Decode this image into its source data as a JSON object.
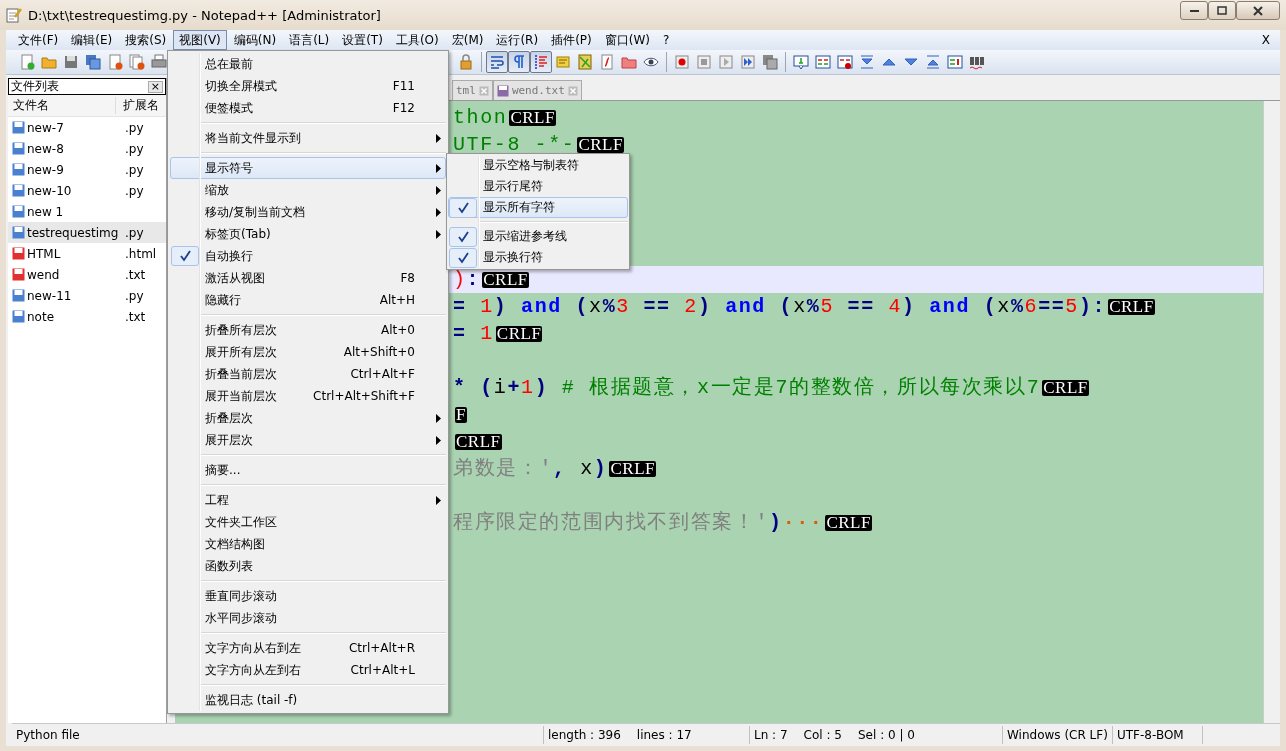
{
  "window": {
    "title": "D:\\txt\\testrequestimg.py - Notepad++ [Administrator]"
  },
  "menubar": {
    "items": [
      {
        "label": "文件(F)",
        "selected": false
      },
      {
        "label": "编辑(E)",
        "selected": false
      },
      {
        "label": "搜索(S)",
        "selected": false
      },
      {
        "label": "视图(V)",
        "selected": true
      },
      {
        "label": "编码(N)",
        "selected": false
      },
      {
        "label": "语言(L)",
        "selected": false
      },
      {
        "label": "设置(T)",
        "selected": false
      },
      {
        "label": "工具(O)",
        "selected": false
      },
      {
        "label": "宏(M)",
        "selected": false
      },
      {
        "label": "运行(R)",
        "selected": false
      },
      {
        "label": "插件(P)",
        "selected": false
      },
      {
        "label": "窗口(W)",
        "selected": false
      },
      {
        "label": "?",
        "selected": false
      }
    ],
    "close_label": "X"
  },
  "toolbar": {
    "left": [
      {
        "kind": "new",
        "pressed": false
      },
      {
        "kind": "open",
        "pressed": false
      },
      {
        "kind": "save",
        "pressed": false
      },
      {
        "kind": "saveall",
        "pressed": false
      },
      {
        "kind": "close",
        "pressed": false
      },
      {
        "kind": "closeall",
        "pressed": false
      },
      {
        "kind": "print",
        "pressed": false
      }
    ],
    "right": [
      {
        "kind": "lock",
        "pressed": false
      },
      {
        "kind": "sep"
      },
      {
        "kind": "wrap",
        "pressed": true
      },
      {
        "kind": "pilcrow",
        "pressed": true
      },
      {
        "kind": "indent",
        "pressed": true
      },
      {
        "kind": "note",
        "pressed": false
      },
      {
        "kind": "map",
        "pressed": false
      },
      {
        "kind": "func",
        "pressed": false
      },
      {
        "kind": "folder",
        "pressed": false
      },
      {
        "kind": "eye",
        "pressed": false
      },
      {
        "kind": "sep"
      },
      {
        "kind": "record",
        "pressed": false
      },
      {
        "kind": "stop",
        "pressed": false
      },
      {
        "kind": "play",
        "pressed": false
      },
      {
        "kind": "playmulti",
        "pressed": false
      },
      {
        "kind": "savemacro",
        "pressed": false
      },
      {
        "kind": "sep"
      },
      {
        "kind": "bookmark",
        "pressed": false
      },
      {
        "kind": "compare",
        "pressed": false
      },
      {
        "kind": "clearcompare",
        "pressed": false
      },
      {
        "kind": "first",
        "pressed": false
      },
      {
        "kind": "prev",
        "pressed": false
      },
      {
        "kind": "next",
        "pressed": false
      },
      {
        "kind": "last",
        "pressed": false
      },
      {
        "kind": "panel",
        "pressed": false
      },
      {
        "kind": "spell",
        "pressed": false
      }
    ]
  },
  "file_list": {
    "title": "文件列表",
    "close_label": "×",
    "columns": [
      "文件名",
      "扩展名"
    ],
    "rows": [
      {
        "name": "new-7",
        "ext": ".py",
        "modified": false,
        "selected": false
      },
      {
        "name": "new-8",
        "ext": ".py",
        "modified": false,
        "selected": false
      },
      {
        "name": "new-9",
        "ext": ".py",
        "modified": false,
        "selected": false
      },
      {
        "name": "new-10",
        "ext": ".py",
        "modified": false,
        "selected": false
      },
      {
        "name": "new 1",
        "modified": false,
        "selected": false
      },
      {
        "name": "testrequestimg",
        "ext": ".py",
        "modified": false,
        "selected": true
      },
      {
        "name": "HTML",
        "ext": ".html",
        "modified": true,
        "selected": false
      },
      {
        "name": "wend",
        "ext": ".txt",
        "modified": true,
        "selected": false
      },
      {
        "name": "new-11",
        "ext": ".py",
        "modified": false,
        "selected": false
      },
      {
        "name": "note",
        "ext": ".txt",
        "modified": false,
        "selected": false
      }
    ]
  },
  "tabs": [
    {
      "label": "tml",
      "selected": false
    },
    {
      "label": "wend.txt",
      "selected": false
    }
  ],
  "editor": {
    "lines": [
      {
        "current": false,
        "tokens": [
          {
            "text": "thon",
            "kind": "comment"
          },
          {
            "text": "CRLF",
            "kind": "eol"
          }
        ]
      },
      {
        "current": false,
        "tokens": [
          {
            "text": "UTF-8 -*-",
            "kind": "comment"
          },
          {
            "text": "CRLF",
            "kind": "eol"
          }
        ]
      },
      {
        "current": false
      },
      {
        "current": false
      },
      {
        "current": false
      },
      {
        "current": false
      },
      {
        "current": true,
        "tokens": [
          {
            "text": ")",
            "kind": "number"
          },
          {
            "text": ":",
            "kind": "operator"
          },
          {
            "text": "CRLF",
            "kind": "eol"
          }
        ]
      },
      {
        "current": false,
        "tokens": [
          {
            "text": "=",
            "kind": "operator"
          },
          {
            "text": " 1",
            "kind": "number"
          },
          {
            "text": ")",
            "kind": "operator"
          },
          {
            "text": " and",
            "kind": "keyword"
          },
          {
            "text": " (",
            "kind": "operator"
          },
          {
            "text": "x",
            "kind": "identifier"
          },
          {
            "text": "%",
            "kind": "operator"
          },
          {
            "text": "3",
            "kind": "number"
          },
          {
            "text": " ==",
            "kind": "operator"
          },
          {
            "text": " 2",
            "kind": "number"
          },
          {
            "text": ")",
            "kind": "operator"
          },
          {
            "text": " and",
            "kind": "keyword"
          },
          {
            "text": " (",
            "kind": "operator"
          },
          {
            "text": "x",
            "kind": "identifier"
          },
          {
            "text": "%",
            "kind": "operator"
          },
          {
            "text": "5",
            "kind": "number"
          },
          {
            "text": " ==",
            "kind": "operator"
          },
          {
            "text": " 4",
            "kind": "number"
          },
          {
            "text": ")",
            "kind": "operator"
          },
          {
            "text": " and",
            "kind": "keyword"
          },
          {
            "text": " (",
            "kind": "operator"
          },
          {
            "text": "x",
            "kind": "identifier"
          },
          {
            "text": "%",
            "kind": "operator"
          },
          {
            "text": "6",
            "kind": "number"
          },
          {
            "text": "==",
            "kind": "operator"
          },
          {
            "text": "5",
            "kind": "number"
          },
          {
            "text": "):",
            "kind": "operator"
          },
          {
            "text": "CRLF",
            "kind": "eol"
          }
        ]
      },
      {
        "current": false,
        "tokens": [
          {
            "text": "=",
            "kind": "operator"
          },
          {
            "text": " 1",
            "kind": "number"
          },
          {
            "text": "CRLF",
            "kind": "eol"
          }
        ]
      },
      {
        "current": false
      },
      {
        "current": false,
        "tokens": [
          {
            "text": "*",
            "kind": "operator"
          },
          {
            "text": " (",
            "kind": "operator"
          },
          {
            "text": "i",
            "kind": "identifier"
          },
          {
            "text": "+",
            "kind": "operator"
          },
          {
            "text": "1",
            "kind": "number"
          },
          {
            "text": ")",
            "kind": "operator"
          },
          {
            "text": " # 根据题意，x一定是7的整数倍，所以每次乘以7",
            "kind": "comment"
          },
          {
            "text": "CRLF",
            "kind": "eol"
          }
        ]
      },
      {
        "current": false,
        "tokens": [
          {
            "text": "F",
            "kind": "eol"
          }
        ]
      },
      {
        "current": false,
        "tokens": [
          {
            "text": "CRLF",
            "kind": "eol"
          }
        ]
      },
      {
        "current": false,
        "tokens": [
          {
            "text": "弟数是：'",
            "kind": "string"
          },
          {
            "text": ",",
            "kind": "operator"
          },
          {
            "text": " x",
            "kind": "identifier"
          },
          {
            "text": ")",
            "kind": "operator"
          },
          {
            "text": "CRLF",
            "kind": "eol"
          }
        ]
      },
      {
        "current": false
      },
      {
        "current": false,
        "tokens": [
          {
            "text": "程序限定的范围内找不到答案！'",
            "kind": "string"
          },
          {
            "text": ")",
            "kind": "operator"
          },
          {
            "text": "···",
            "kind": "whitespace"
          },
          {
            "text": "CRLF",
            "kind": "eol"
          }
        ]
      }
    ]
  },
  "view_menu": {
    "items": [
      {
        "kind": "item",
        "label": "总在最前",
        "submenu": false,
        "checked": false,
        "selected": false
      },
      {
        "kind": "item",
        "label": "切换全屏模式",
        "shortcut": "F11",
        "submenu": false,
        "checked": false,
        "selected": false
      },
      {
        "kind": "item",
        "label": "便签模式",
        "shortcut": "F12",
        "submenu": false,
        "checked": false,
        "selected": false
      },
      {
        "kind": "separator"
      },
      {
        "kind": "item",
        "label": "将当前文件显示到",
        "submenu": true,
        "checked": false,
        "selected": false
      },
      {
        "kind": "separator"
      },
      {
        "kind": "item",
        "label": "显示符号",
        "submenu": true,
        "checked": false,
        "selected": true
      },
      {
        "kind": "item",
        "label": "缩放",
        "submenu": true,
        "checked": false,
        "selected": false
      },
      {
        "kind": "item",
        "label": "移动/复制当前文档",
        "submenu": true,
        "checked": false,
        "selected": false
      },
      {
        "kind": "item",
        "label": "标签页(Tab)",
        "submenu": true,
        "checked": false,
        "selected": false
      },
      {
        "kind": "item",
        "label": "自动换行",
        "submenu": false,
        "checked": true,
        "selected": false
      },
      {
        "kind": "item",
        "label": "激活从视图",
        "shortcut": "F8",
        "submenu": false,
        "checked": false,
        "selected": false
      },
      {
        "kind": "item",
        "label": "隐藏行",
        "shortcut": "Alt+H",
        "submenu": false,
        "checked": false,
        "selected": false
      },
      {
        "kind": "separator"
      },
      {
        "kind": "item",
        "label": "折叠所有层次",
        "shortcut": "Alt+0",
        "submenu": false,
        "checked": false,
        "selected": false
      },
      {
        "kind": "item",
        "label": "展开所有层次",
        "shortcut": "Alt+Shift+0",
        "submenu": false,
        "checked": false,
        "selected": false
      },
      {
        "kind": "item",
        "label": "折叠当前层次",
        "shortcut": "Ctrl+Alt+F",
        "submenu": false,
        "checked": false,
        "selected": false
      },
      {
        "kind": "item",
        "label": "展开当前层次",
        "shortcut": "Ctrl+Alt+Shift+F",
        "submenu": false,
        "checked": false,
        "selected": false
      },
      {
        "kind": "item",
        "label": "折叠层次",
        "submenu": true,
        "checked": false,
        "selected": false
      },
      {
        "kind": "item",
        "label": "展开层次",
        "submenu": true,
        "checked": false,
        "selected": false
      },
      {
        "kind": "separator"
      },
      {
        "kind": "item",
        "label": "摘要...",
        "submenu": false,
        "checked": false,
        "selected": false
      },
      {
        "kind": "separator"
      },
      {
        "kind": "item",
        "label": "工程",
        "submenu": true,
        "checked": false,
        "selected": false
      },
      {
        "kind": "item",
        "label": "文件夹工作区",
        "submenu": false,
        "checked": false,
        "selected": false
      },
      {
        "kind": "item",
        "label": "文档结构图",
        "submenu": false,
        "checked": false,
        "selected": false
      },
      {
        "kind": "item",
        "label": "函数列表",
        "submenu": false,
        "checked": false,
        "selected": false
      },
      {
        "kind": "separator"
      },
      {
        "kind": "item",
        "label": "垂直同步滚动",
        "submenu": false,
        "checked": false,
        "selected": false
      },
      {
        "kind": "item",
        "label": "水平同步滚动",
        "submenu": false,
        "checked": false,
        "selected": false
      },
      {
        "kind": "separator"
      },
      {
        "kind": "item",
        "label": "文字方向从右到左",
        "shortcut": "Ctrl+Alt+R",
        "submenu": false,
        "checked": false,
        "selected": false
      },
      {
        "kind": "item",
        "label": "文字方向从左到右",
        "shortcut": "Ctrl+Alt+L",
        "submenu": false,
        "checked": false,
        "selected": false
      },
      {
        "kind": "separator"
      },
      {
        "kind": "item",
        "label": "监视日志 (tail -f)",
        "submenu": false,
        "checked": false,
        "selected": false
      }
    ]
  },
  "symbol_submenu": {
    "items": [
      {
        "kind": "item",
        "label": "显示空格与制表符",
        "checked": false,
        "selected": false
      },
      {
        "kind": "item",
        "label": "显示行尾符",
        "checked": false,
        "selected": false
      },
      {
        "kind": "item",
        "label": "显示所有字符",
        "checked": true,
        "selected": true
      },
      {
        "kind": "separator"
      },
      {
        "kind": "item",
        "label": "显示缩进参考线",
        "checked": true,
        "selected": false
      },
      {
        "kind": "item",
        "label": "显示换行符",
        "checked": true,
        "selected": false
      }
    ]
  },
  "status_bar": {
    "file_type": "Python file",
    "length": "length : 396",
    "lines": "lines : 17",
    "ln": "Ln : 7",
    "col": "Col : 5",
    "sel": "Sel : 0 | 0",
    "eol": "Windows (CR LF)",
    "encoding": "UTF-8-BOM"
  }
}
